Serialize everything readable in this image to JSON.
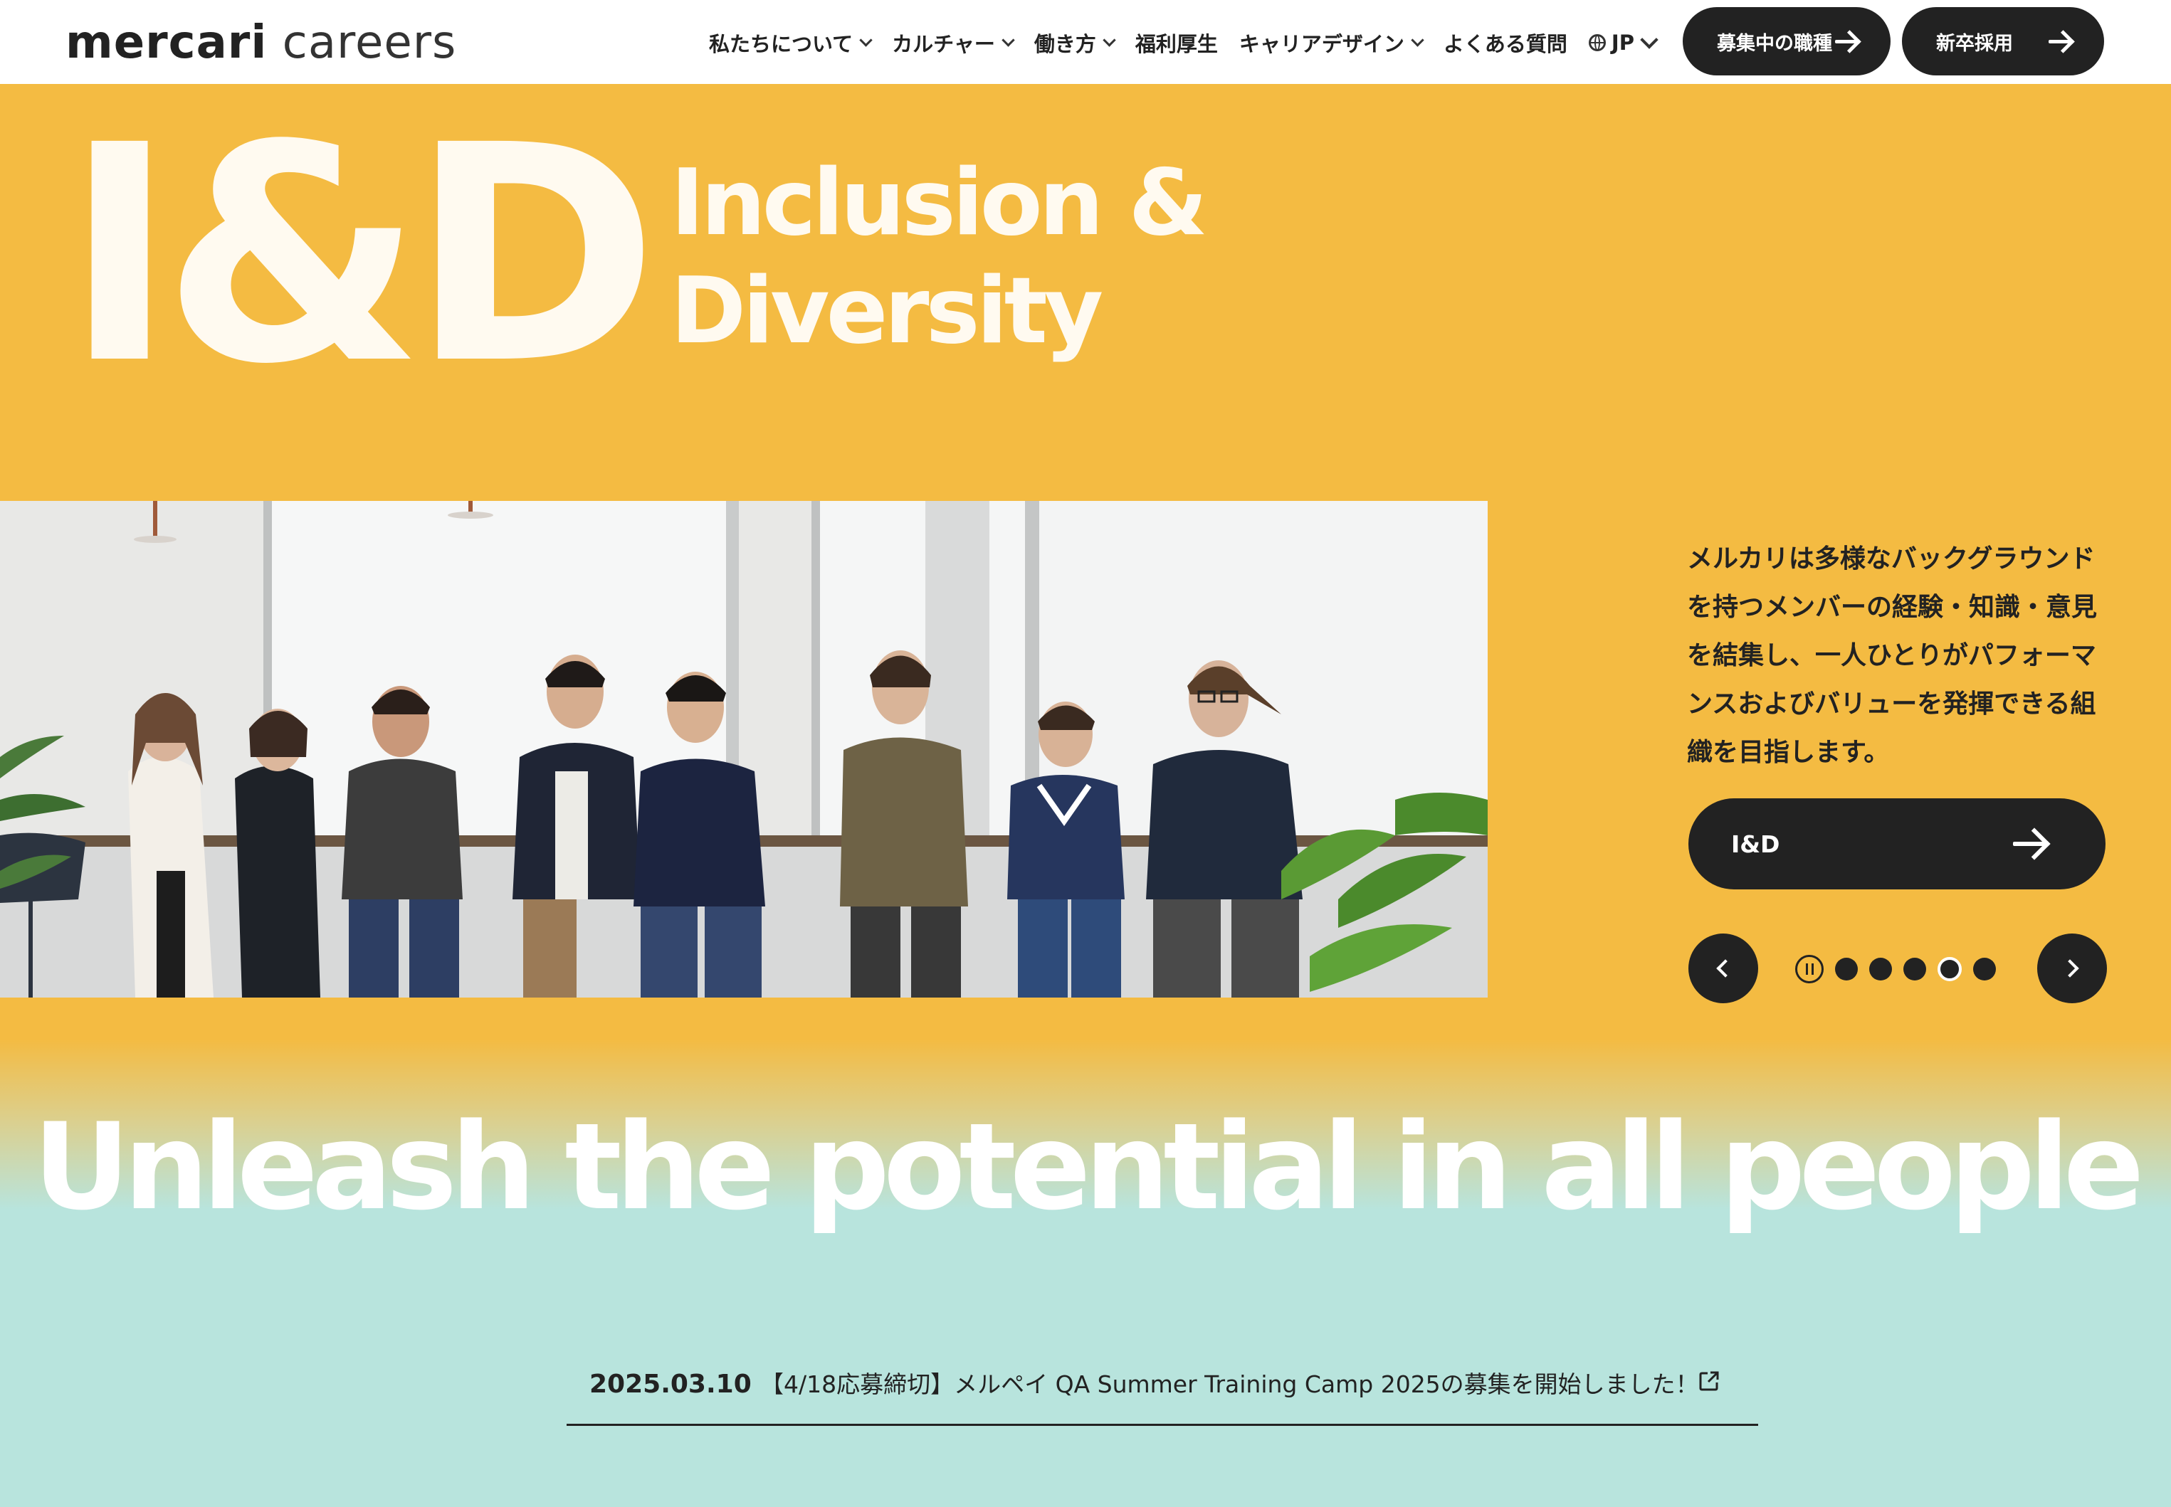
{
  "header": {
    "logo_brand": "mercari",
    "logo_sub": "careers",
    "nav": [
      {
        "label": "私たちについて",
        "has_dropdown": true
      },
      {
        "label": "カルチャー",
        "has_dropdown": true
      },
      {
        "label": "働き方",
        "has_dropdown": true
      },
      {
        "label": "福利厚生",
        "has_dropdown": false
      },
      {
        "label": "キャリアデザイン",
        "has_dropdown": true
      },
      {
        "label": "よくある質問",
        "has_dropdown": false
      }
    ],
    "language": "JP",
    "jobs_button": "募集中の職種",
    "grad_button": "新卒採用"
  },
  "hero": {
    "big_label": "I&D",
    "title_line1": "Inclusion &",
    "title_line2": "Diversity",
    "description": "メルカリは多様なバックグラウンドを持つメンバーの経験・知識・意見を結集し、一人ひとりがパフォーマンスおよびバリューを発揮できる組織を目指します。",
    "cta_label": "I&D",
    "slide_count": 5,
    "active_slide": 4,
    "bg_color": "#f4bb42"
  },
  "slogan": "Unleash the potential in all people",
  "news": {
    "date": "2025.03.10",
    "text": "【4/18応募締切】メルペイ QA Summer Training Camp 2025の募集を開始しました！"
  },
  "icons": {
    "nav_dropdown": "chevron-down-icon",
    "language": "globe-icon",
    "button_arrow": "arrow-right-icon",
    "prev": "chevron-left-icon",
    "next": "chevron-right-icon",
    "pause": "pause-icon",
    "external": "external-link-icon"
  }
}
